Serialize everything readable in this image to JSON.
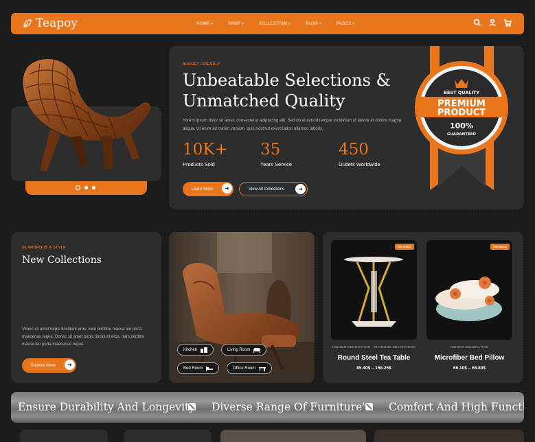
{
  "brand": {
    "name": "Teapoy"
  },
  "nav": {
    "items": [
      {
        "label": "HOME"
      },
      {
        "label": "SHOP"
      },
      {
        "label": "COLLECTION"
      },
      {
        "label": "BLOG"
      },
      {
        "label": "PAGES"
      }
    ],
    "icons": [
      "search-icon",
      "user-icon",
      "cart-icon"
    ]
  },
  "hero": {
    "eyebrow": "BUDGET FRIENDLY",
    "title": "Unbeatable Selections & Unmatched Quality",
    "description": "Yorem ipsum dolor sit amet, consectetur adipiscing elit. Sed do eiusmod tempor incididunt ut labore et dolore magna aliqua. Ut enim ad minim veniam, quis nostrud exercitation ullamco laboris.",
    "stats": [
      {
        "value": "10K+",
        "label": "Products Sold"
      },
      {
        "value": "35",
        "label": "Years Service"
      },
      {
        "value": "450",
        "label": "Outlets Worldwide"
      }
    ],
    "primary_button": "Learn More",
    "secondary_button": "View All Collections",
    "slider_active_index": 0,
    "slider_count": 3,
    "badge": {
      "top": "BEST QUALITY",
      "line1": "PREMIUM",
      "line2": "PRODUCT",
      "percent": "100%",
      "bottom": "GUARANTEED"
    }
  },
  "collection": {
    "eyebrow": "GLAMOROUS & STYLE",
    "title": "New Collections",
    "description": "Venec sit amet turpis tincidunt eros, nam porttitor massa leo porta maecenas reque. Donec sit amet turpis tincidunt eros, nam porttitor massa leo porta maecenas reque.",
    "button": "Explore More"
  },
  "rooms": [
    {
      "label": "Kitchen",
      "icon": "kitchen-icon"
    },
    {
      "label": "Living Room",
      "icon": "sofa-icon"
    },
    {
      "label": "Bed Room",
      "icon": "bed-icon"
    },
    {
      "label": "Office Room",
      "icon": "desk-icon"
    }
  ],
  "products": [
    {
      "badge": "ON SALE",
      "category": "INDOOR DECORATION , OUTDOOR DECORATION",
      "name": "Round Steel Tea Table",
      "price": "85.40$ – 156.25$"
    },
    {
      "badge": "ON SALE",
      "category": "INDOOR DECORATION",
      "name": "Microfiber Bed Pillow",
      "price": "66.10$ – 66.80$"
    }
  ],
  "marquee": {
    "items": [
      "Ensure Durability And Longevity.",
      "Diverse Range Of Furniture's.",
      "Comfort And High Functional"
    ]
  },
  "colors": {
    "accent": "#e9761c",
    "panel": "#2d2d2d",
    "background": "#1b1b1b"
  }
}
